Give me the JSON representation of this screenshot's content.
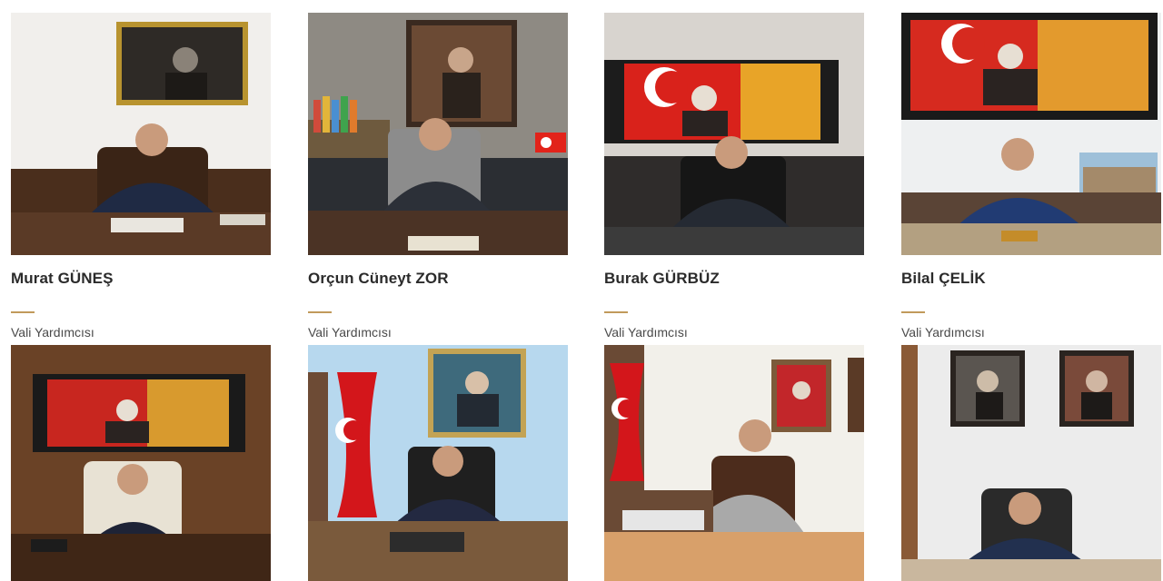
{
  "accent_color": "#c19a5b",
  "officials": [
    {
      "name": "Murat GÜNEŞ",
      "title": "Vali Yardımcısı"
    },
    {
      "name": "Orçun Cüneyt ZOR",
      "title": "Vali Yardımcısı"
    },
    {
      "name": "Burak GÜRBÜZ",
      "title": "Vali Yardımcısı"
    },
    {
      "name": "Bilal ÇELİK",
      "title": "Vali Yardımcısı"
    },
    {
      "name": "",
      "title": ""
    },
    {
      "name": "",
      "title": ""
    },
    {
      "name": "",
      "title": ""
    },
    {
      "name": "",
      "title": ""
    }
  ]
}
